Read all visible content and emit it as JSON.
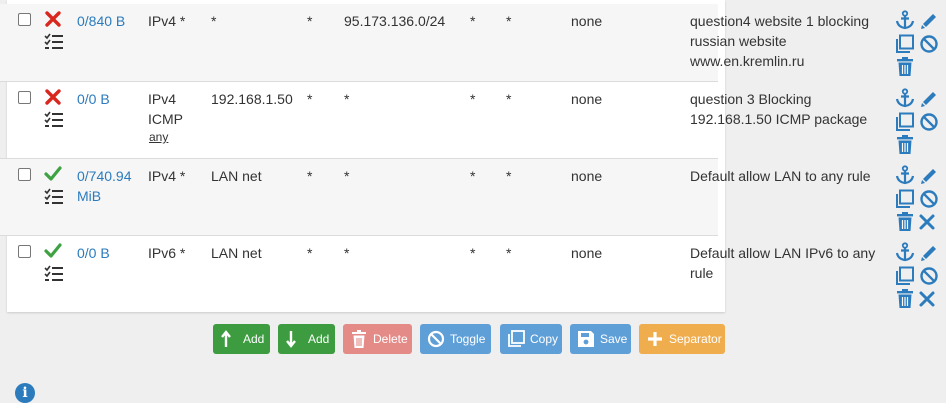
{
  "rows": [
    {
      "status": "block",
      "states": "0/840 B",
      "protocol": "IPv4 *",
      "protocol_sub": "",
      "source": "*",
      "source_port": "*",
      "destination": "95.173.136.0/24",
      "destination_port": "*",
      "gateway": "*",
      "queue": "none",
      "description": "question4 website 1 blocking russian website www.en.kremlin.ru",
      "actions": [
        "anchor-icon",
        "edit-icon",
        "copy-icon",
        "disable-icon",
        "delete-icon"
      ]
    },
    {
      "status": "block",
      "states": "0/0 B",
      "protocol": "IPv4 ICMP",
      "protocol_sub": "any",
      "source": "192.168.1.50",
      "source_port": "*",
      "destination": "*",
      "destination_port": "*",
      "gateway": "*",
      "queue": "none",
      "description": "question 3 Blocking 192.168.1.50 ICMP package",
      "actions": [
        "anchor-icon",
        "edit-icon",
        "copy-icon",
        "disable-icon",
        "delete-icon"
      ]
    },
    {
      "status": "pass",
      "states": "0/740.94 MiB",
      "protocol": "IPv4 *",
      "protocol_sub": "",
      "source": "LAN net",
      "source_port": "*",
      "destination": "*",
      "destination_port": "*",
      "gateway": "*",
      "queue": "none",
      "description": "Default allow LAN to any rule",
      "actions": [
        "anchor-icon",
        "edit-icon",
        "copy-icon",
        "disable-icon",
        "delete-icon",
        "close-icon"
      ]
    },
    {
      "status": "pass",
      "states": "0/0 B",
      "protocol": "IPv6 *",
      "protocol_sub": "",
      "source": "LAN net",
      "source_port": "*",
      "destination": "*",
      "destination_port": "*",
      "gateway": "*",
      "queue": "none",
      "description": "Default allow LAN IPv6 to any rule",
      "actions": [
        "anchor-icon",
        "edit-icon",
        "copy-icon",
        "disable-icon",
        "delete-icon",
        "close-icon"
      ]
    }
  ],
  "buttons": {
    "add_top": "Add",
    "add_bottom": "Add",
    "delete": "Delete",
    "toggle": "Toggle",
    "copy": "Copy",
    "save": "Save",
    "separator": "Separator"
  },
  "info_icon": "i",
  "colors": {
    "block": "#d9271e",
    "pass": "#3fa242",
    "link": "#2b7bbd",
    "btn_green": "#3c9c3f",
    "btn_red": "#e48a87",
    "btn_blue": "#5f9fd8",
    "btn_orange": "#f0ad4e"
  }
}
